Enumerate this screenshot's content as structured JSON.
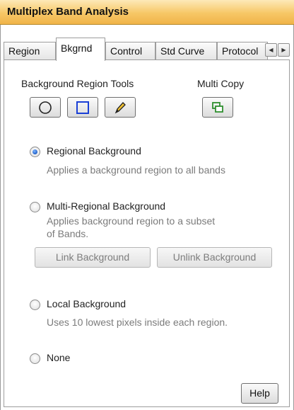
{
  "window": {
    "title": "Multiplex Band Analysis"
  },
  "tabs": [
    {
      "label": "Region",
      "active": false
    },
    {
      "label": "Bkgrnd",
      "active": true
    },
    {
      "label": "Control",
      "active": false
    },
    {
      "label": "Std Curve",
      "active": false
    },
    {
      "label": "Protocol",
      "active": false
    }
  ],
  "tab_scroll": {
    "left_icon": "arrow-left-icon",
    "right_icon": "arrow-right-icon"
  },
  "tools": {
    "heading": "Background Region Tools",
    "multi_copy_heading": "Multi Copy",
    "buttons": [
      {
        "icon": "ellipse-tool-icon"
      },
      {
        "icon": "rectangle-tool-icon"
      },
      {
        "icon": "pencil-tool-icon"
      }
    ],
    "multi_copy_icon": "multi-copy-icon",
    "accent_color": "#1a3fd6",
    "copy_icon_color": "#2f8f2f"
  },
  "options": [
    {
      "label": "Regional Background",
      "desc": "Applies a background region to all bands",
      "checked": true
    },
    {
      "label": "Multi-Regional Background",
      "desc1": "Applies background region to a subset",
      "desc2": "of Bands.",
      "checked": false
    },
    {
      "label": "Local Background",
      "desc": "Uses 10 lowest pixels inside each region.",
      "checked": false
    },
    {
      "label": "None",
      "checked": false
    }
  ],
  "link_buttons": {
    "link": "Link Background",
    "unlink": "Unlink Background"
  },
  "help_button": "Help"
}
